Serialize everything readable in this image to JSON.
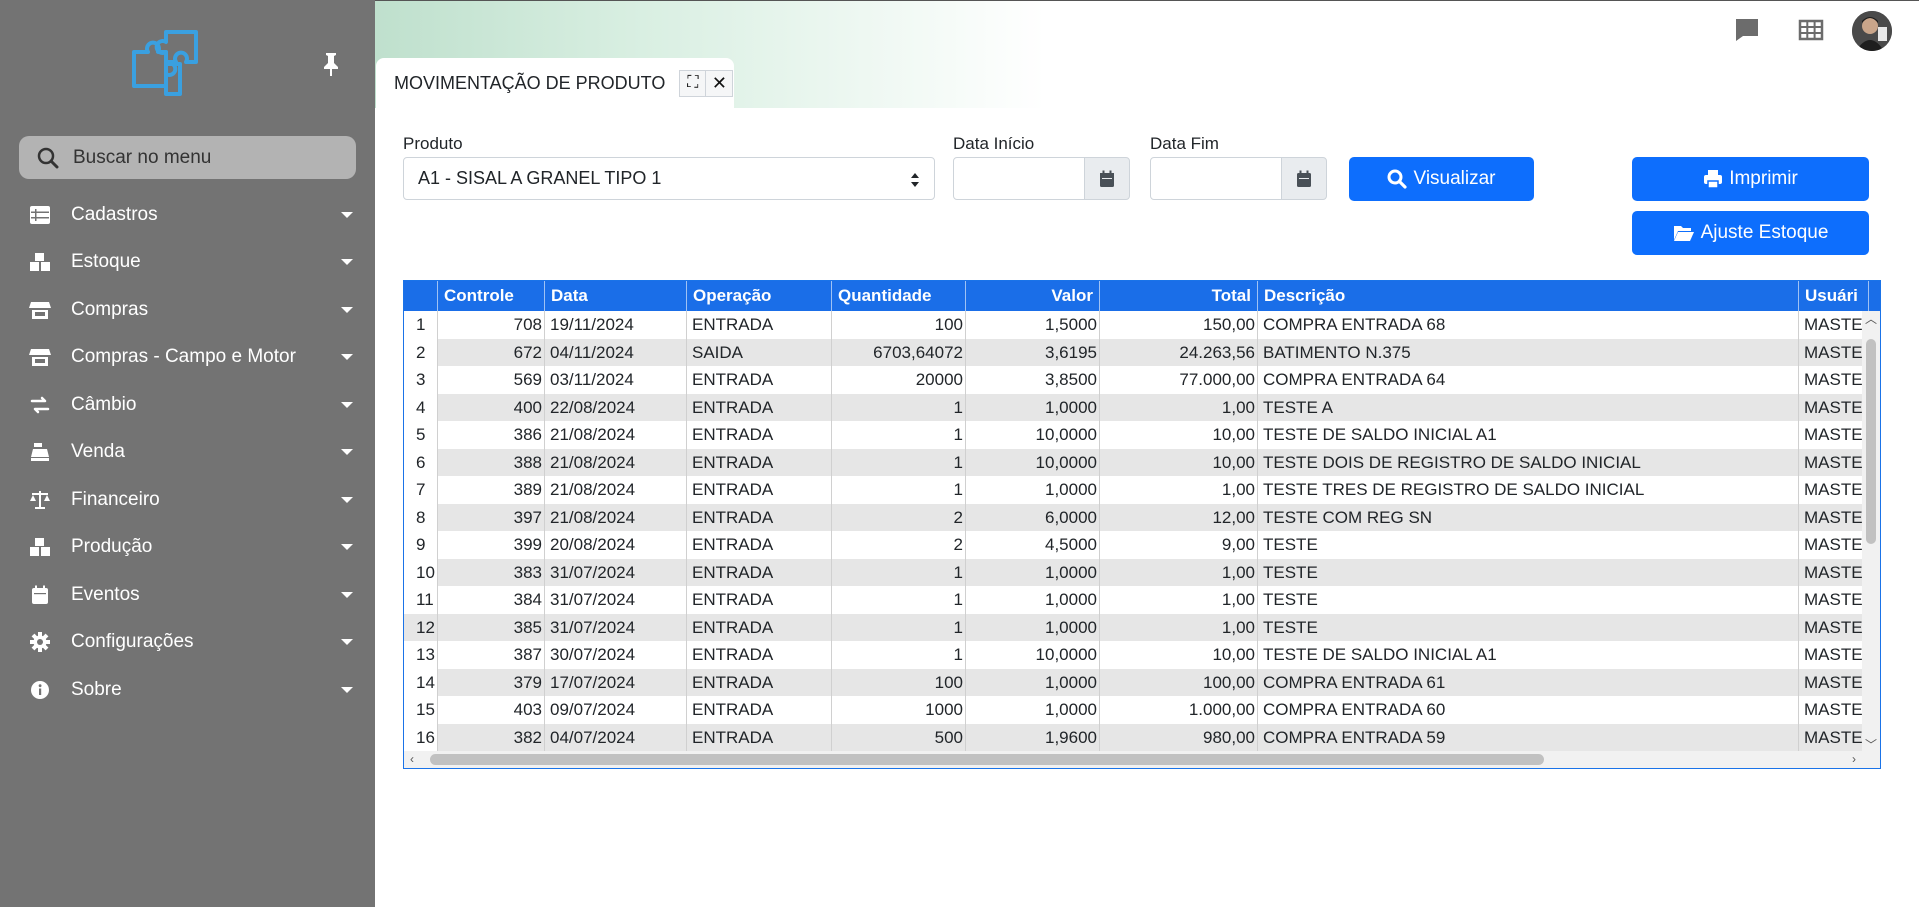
{
  "sidebar": {
    "search_placeholder": "Buscar no menu",
    "items": [
      {
        "label": "Cadastros",
        "icon": "list-icon"
      },
      {
        "label": "Estoque",
        "icon": "boxes-icon"
      },
      {
        "label": "Compras",
        "icon": "store-icon"
      },
      {
        "label": "Compras - Campo e Motor",
        "icon": "store-icon"
      },
      {
        "label": "Câmbio",
        "icon": "exchange-icon"
      },
      {
        "label": "Venda",
        "icon": "cash-register-icon"
      },
      {
        "label": "Financeiro",
        "icon": "scale-icon"
      },
      {
        "label": "Produção",
        "icon": "boxes-icon"
      },
      {
        "label": "Eventos",
        "icon": "calendar-icon"
      },
      {
        "label": "Configurações",
        "icon": "gear-icon"
      },
      {
        "label": "Sobre",
        "icon": "info-icon"
      }
    ]
  },
  "tab": {
    "title": "MOVIMENTAÇÃO DE PRODUTO",
    "expand_glyph": "⛶",
    "close_glyph": "✕"
  },
  "form": {
    "produto_label": "Produto",
    "produto_value": "A1 - SISAL A GRANEL TIPO 1",
    "data_inicio_label": "Data Início",
    "data_fim_label": "Data Fim",
    "visualizar_label": "Visualizar",
    "imprimir_label": "Imprimir",
    "ajuste_label": "Ajuste Estoque"
  },
  "grid": {
    "columns": [
      "",
      "Controle",
      "Data",
      "Operação",
      "Quantidade",
      "Valor",
      "Total",
      "Descrição",
      "Usuári"
    ],
    "rows": [
      [
        "1",
        "708",
        "19/11/2024",
        "ENTRADA",
        "100",
        "1,5000",
        "150,00",
        "COMPRA ENTRADA 68",
        "MASTE"
      ],
      [
        "2",
        "672",
        "04/11/2024",
        "SAIDA",
        "6703,64072",
        "3,6195",
        "24.263,56",
        "BATIMENTO N.375",
        "MASTE"
      ],
      [
        "3",
        "569",
        "03/11/2024",
        "ENTRADA",
        "20000",
        "3,8500",
        "77.000,00",
        "COMPRA ENTRADA 64",
        "MASTE"
      ],
      [
        "4",
        "400",
        "22/08/2024",
        "ENTRADA",
        "1",
        "1,0000",
        "1,00",
        "TESTE A",
        "MASTE"
      ],
      [
        "5",
        "386",
        "21/08/2024",
        "ENTRADA",
        "1",
        "10,0000",
        "10,00",
        "TESTE DE SALDO INICIAL A1",
        "MASTE"
      ],
      [
        "6",
        "388",
        "21/08/2024",
        "ENTRADA",
        "1",
        "10,0000",
        "10,00",
        "TESTE DOIS DE REGISTRO DE SALDO INICIAL",
        "MASTE"
      ],
      [
        "7",
        "389",
        "21/08/2024",
        "ENTRADA",
        "1",
        "1,0000",
        "1,00",
        "TESTE TRES DE REGISTRO DE SALDO INICIAL",
        "MASTE"
      ],
      [
        "8",
        "397",
        "21/08/2024",
        "ENTRADA",
        "2",
        "6,0000",
        "12,00",
        "TESTE COM REG SN",
        "MASTE"
      ],
      [
        "9",
        "399",
        "20/08/2024",
        "ENTRADA",
        "2",
        "4,5000",
        "9,00",
        "TESTE",
        "MASTE"
      ],
      [
        "10",
        "383",
        "31/07/2024",
        "ENTRADA",
        "1",
        "1,0000",
        "1,00",
        "TESTE",
        "MASTE"
      ],
      [
        "11",
        "384",
        "31/07/2024",
        "ENTRADA",
        "1",
        "1,0000",
        "1,00",
        "TESTE",
        "MASTE"
      ],
      [
        "12",
        "385",
        "31/07/2024",
        "ENTRADA",
        "1",
        "1,0000",
        "1,00",
        "TESTE",
        "MASTE"
      ],
      [
        "13",
        "387",
        "30/07/2024",
        "ENTRADA",
        "1",
        "10,0000",
        "10,00",
        "TESTE DE SALDO INICIAL A1",
        "MASTE"
      ],
      [
        "14",
        "379",
        "17/07/2024",
        "ENTRADA",
        "100",
        "1,0000",
        "100,00",
        "COMPRA ENTRADA 61",
        "MASTE"
      ],
      [
        "15",
        "403",
        "09/07/2024",
        "ENTRADA",
        "1000",
        "1,0000",
        "1.000,00",
        "COMPRA ENTRADA 60",
        "MASTE"
      ],
      [
        "16",
        "382",
        "04/07/2024",
        "ENTRADA",
        "500",
        "1,9600",
        "980,00",
        "COMPRA ENTRADA 59",
        "MASTE"
      ]
    ]
  },
  "colors": {
    "sidebar_bg": "#737373",
    "primary": "#0d6efd",
    "grid_header": "#1a6ee8",
    "logo": "#3aa0e0"
  }
}
